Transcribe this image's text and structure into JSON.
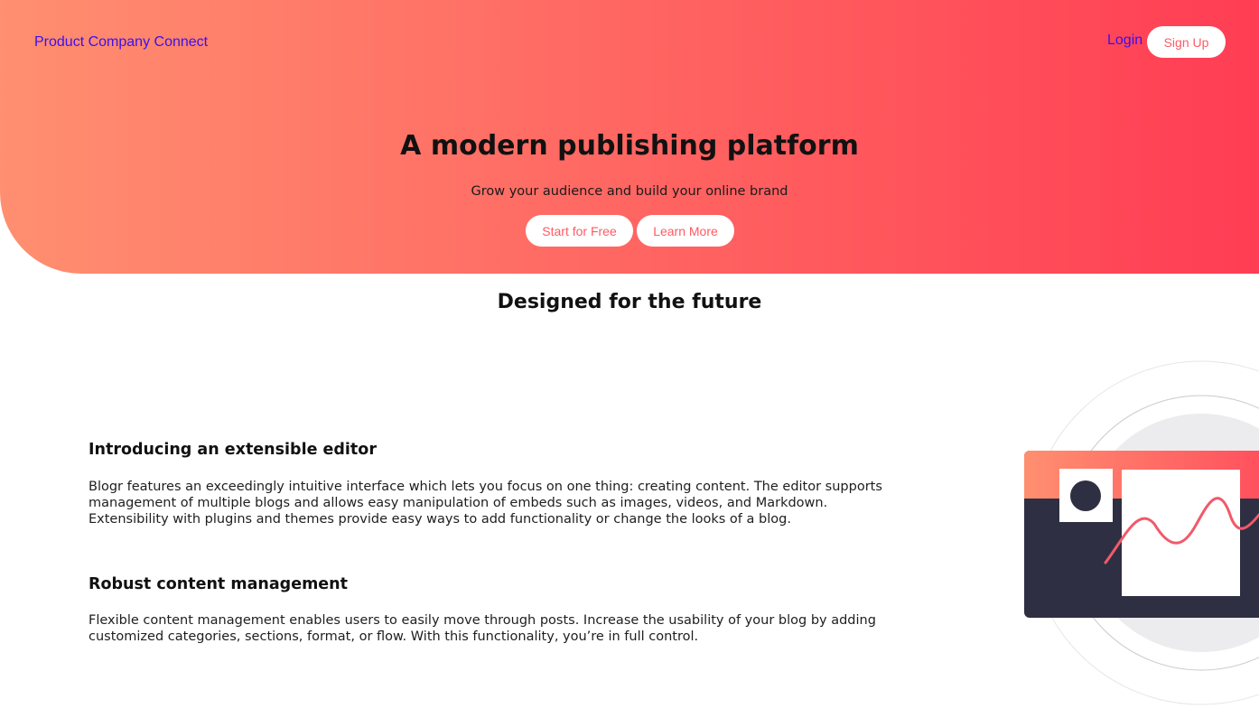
{
  "header": {
    "brand": "Product Company Connect",
    "login": "Login",
    "signup": "Sign Up"
  },
  "hero": {
    "title": "A modern publishing platform",
    "subtitle": "Grow your audience and build your online brand",
    "start_button": "Start for Free",
    "learn_button": "Learn More"
  },
  "section": {
    "title": "Designed for the future",
    "features": [
      {
        "title": "Introducing an extensible editor",
        "body": "Blogr features an exceedingly intuitive interface which lets you focus on one thing: creating content. The editor supports management of multiple blogs and allows easy manipulation of embeds such as images, videos, and Markdown. Extensibility with plugins and themes provide easy ways to add functionality or change the looks of a blog."
      },
      {
        "title": "Robust content management",
        "body": "Flexible content management enables users to easily move through posts. Increase the usability of your blog by adding customized categories, sections, format, or flow. With this functionality, you’re in full control."
      }
    ]
  },
  "colors": {
    "gradient_start": "#ff8f70",
    "gradient_end": "#ff3d54",
    "link": "#3a0ff0",
    "button_text": "#ff5a64",
    "illustration_dark": "#2e2f42"
  },
  "icons": {
    "illustration": "editor-illustration"
  }
}
